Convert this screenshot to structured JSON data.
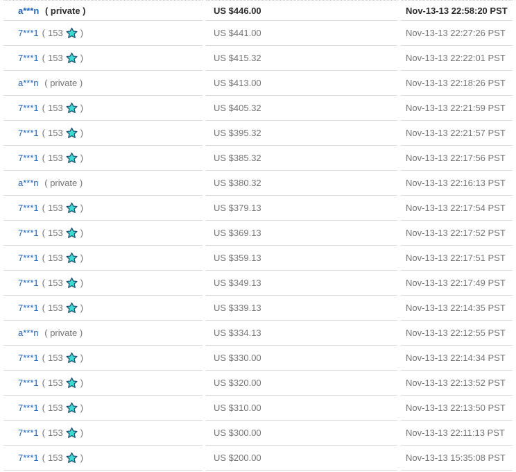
{
  "labels": {
    "private": "( private )",
    "paren_open": "(",
    "paren_close": ")"
  },
  "colors": {
    "link_blue": "#1e63c0",
    "text_gray": "#747474",
    "bold_text": "#2b2b2b",
    "row_border": "#dcdcdc",
    "top_dotted_border": "#c8c8c8",
    "star_fill": "#3ddbd1",
    "star_outline": "#1e4e73"
  },
  "table": {
    "rows": [
      {
        "bidder": "a***n",
        "private": true,
        "amount": "US $446.00",
        "time": "Nov-13-13 22:58:20 PST",
        "highlight": true
      },
      {
        "bidder": "7***1",
        "feedback": "153",
        "amount": "US $441.00",
        "time": "Nov-13-13 22:27:26 PST"
      },
      {
        "bidder": "7***1",
        "feedback": "153",
        "amount": "US $415.32",
        "time": "Nov-13-13 22:22:01 PST"
      },
      {
        "bidder": "a***n",
        "private": true,
        "amount": "US $413.00",
        "time": "Nov-13-13 22:18:26 PST"
      },
      {
        "bidder": "7***1",
        "feedback": "153",
        "amount": "US $405.32",
        "time": "Nov-13-13 22:21:59 PST"
      },
      {
        "bidder": "7***1",
        "feedback": "153",
        "amount": "US $395.32",
        "time": "Nov-13-13 22:21:57 PST"
      },
      {
        "bidder": "7***1",
        "feedback": "153",
        "amount": "US $385.32",
        "time": "Nov-13-13 22:17:56 PST"
      },
      {
        "bidder": "a***n",
        "private": true,
        "amount": "US $380.32",
        "time": "Nov-13-13 22:16:13 PST"
      },
      {
        "bidder": "7***1",
        "feedback": "153",
        "amount": "US $379.13",
        "time": "Nov-13-13 22:17:54 PST"
      },
      {
        "bidder": "7***1",
        "feedback": "153",
        "amount": "US $369.13",
        "time": "Nov-13-13 22:17:52 PST"
      },
      {
        "bidder": "7***1",
        "feedback": "153",
        "amount": "US $359.13",
        "time": "Nov-13-13 22:17:51 PST"
      },
      {
        "bidder": "7***1",
        "feedback": "153",
        "amount": "US $349.13",
        "time": "Nov-13-13 22:17:49 PST"
      },
      {
        "bidder": "7***1",
        "feedback": "153",
        "amount": "US $339.13",
        "time": "Nov-13-13 22:14:35 PST"
      },
      {
        "bidder": "a***n",
        "private": true,
        "amount": "US $334.13",
        "time": "Nov-13-13 22:12:55 PST"
      },
      {
        "bidder": "7***1",
        "feedback": "153",
        "amount": "US $330.00",
        "time": "Nov-13-13 22:14:34 PST"
      },
      {
        "bidder": "7***1",
        "feedback": "153",
        "amount": "US $320.00",
        "time": "Nov-13-13 22:13:52 PST"
      },
      {
        "bidder": "7***1",
        "feedback": "153",
        "amount": "US $310.00",
        "time": "Nov-13-13 22:13:50 PST"
      },
      {
        "bidder": "7***1",
        "feedback": "153",
        "amount": "US $300.00",
        "time": "Nov-13-13 22:11:13 PST"
      },
      {
        "bidder": "7***1",
        "feedback": "153",
        "amount": "US $200.00",
        "time": "Nov-13-13 15:35:08 PST"
      }
    ]
  }
}
